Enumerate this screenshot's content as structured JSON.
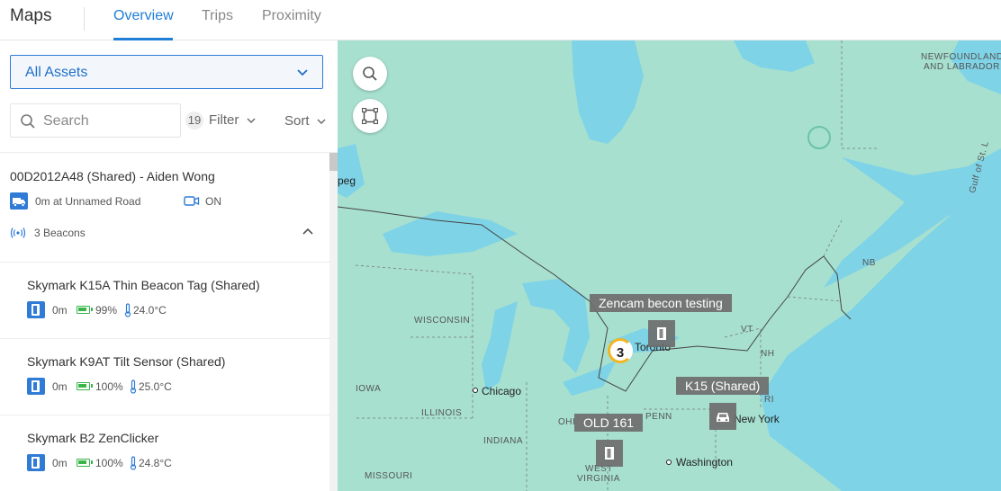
{
  "header": {
    "title": "Maps",
    "tabs": [
      {
        "label": "Overview",
        "active": true
      },
      {
        "label": "Trips",
        "active": false
      },
      {
        "label": "Proximity",
        "active": false
      }
    ]
  },
  "sidebar": {
    "asset_select": {
      "value": "All Assets"
    },
    "search": {
      "placeholder": "Search",
      "value": ""
    },
    "count": "19",
    "filter_label": "Filter",
    "sort_label": "Sort",
    "asset": {
      "name": "00D2012A48 (Shared) - Aiden Wong",
      "location": "0m at Unnamed Road",
      "camera_status": "ON",
      "beacons_label": "3 Beacons"
    },
    "beacons": [
      {
        "name": "Skymark K15A Thin Beacon Tag (Shared)",
        "distance": "0m",
        "battery": "99%",
        "temperature": "24.0°C"
      },
      {
        "name": "Skymark K9AT Tilt Sensor (Shared)",
        "distance": "0m",
        "battery": "100%",
        "temperature": "25.0°C"
      },
      {
        "name": "Skymark B2 ZenClicker",
        "distance": "0m",
        "battery": "100%",
        "temperature": "24.8°C"
      }
    ]
  },
  "map": {
    "region_labels": {
      "newfoundland": "NEWFOUNDLAND",
      "labrador": "AND LABRADOR",
      "nb": "NB",
      "wisconsin": "WISCONSIN",
      "iowa": "IOWA",
      "illinois": "ILLINOIS",
      "indiana": "INDIANA",
      "ohio": "OHI",
      "missouri": "MISSOURI",
      "west": "WEST",
      "virginia": "VIRGINIA",
      "penn": "PENN",
      "vt": "VT",
      "nh": "NH",
      "ri": "RI",
      "gulf": "Gulf of St. L",
      "peg": "peg"
    },
    "cities": {
      "chicago": "Chicago",
      "toronto": "Toronto",
      "new_york": "New York",
      "washington": "Washington"
    },
    "tags": {
      "zencam": "Zencam becon testing",
      "k15": "K15 (Shared)",
      "old": "OLD 161"
    },
    "cluster_count": "3",
    "colors": {
      "water": "#7fd3e6",
      "land": "#a5dfd0",
      "accent": "#1f7ed6"
    }
  }
}
